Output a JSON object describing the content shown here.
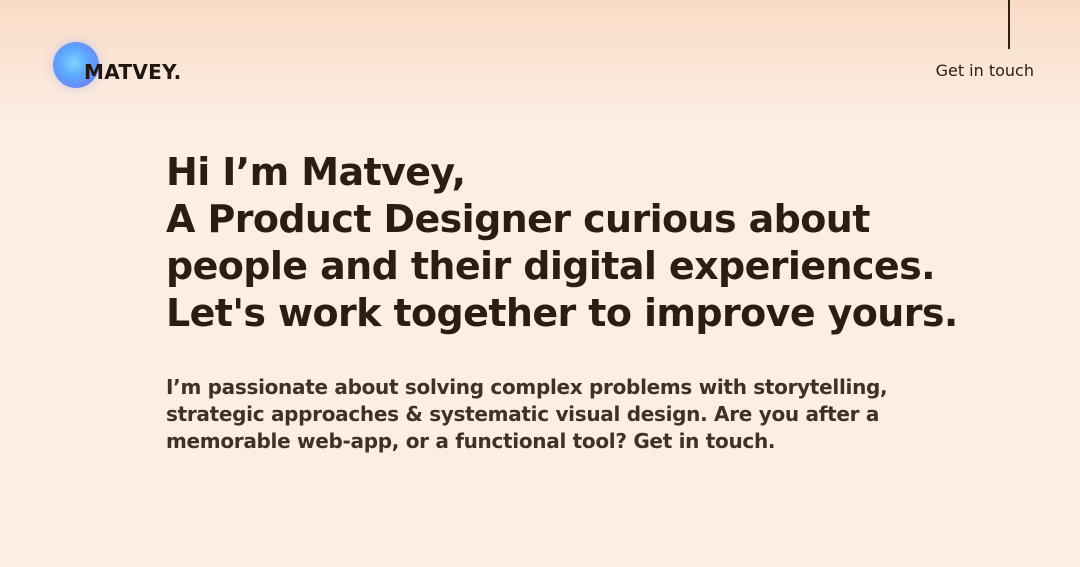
{
  "header": {
    "logo_text": "MATVEY.",
    "nav_link": "Get in touch"
  },
  "hero": {
    "heading_lines": [
      "Hi I’m Matvey,",
      "A Product Designer curious about",
      "people and their digital experiences.",
      "Let's work together to improve yours."
    ],
    "body_lines": [
      "I’m passionate about solving complex problems with storytelling,",
      "strategic approaches & systematic visual design. Are you after a",
      "memorable web-app, or a functional tool? Get in touch."
    ]
  },
  "colors": {
    "background": "#fdeee4",
    "text": "#2b1d12",
    "orb_blue": "#5aa8ff",
    "orb_violet": "#8f7ff0"
  }
}
